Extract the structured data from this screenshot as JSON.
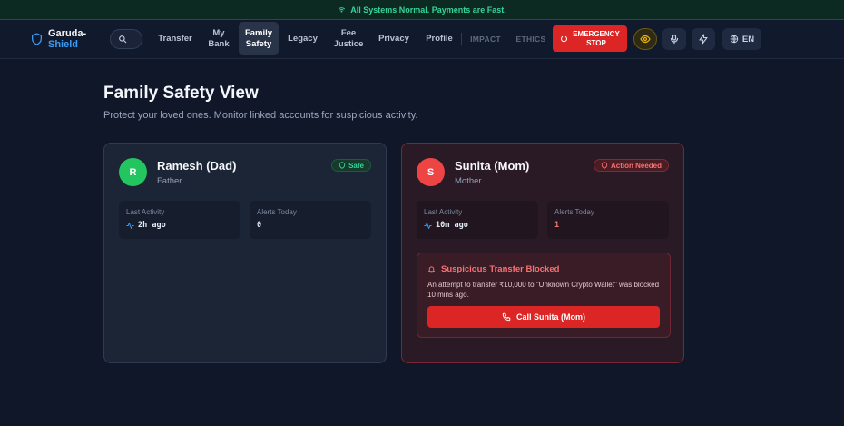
{
  "status_banner": {
    "text": "All Systems Normal. Payments are Fast.",
    "icon": "wifi-icon"
  },
  "brand": {
    "line1": "Garuda-",
    "line2": "Shield",
    "icon": "shield-icon"
  },
  "nav": {
    "items": [
      {
        "label": "Transfer"
      },
      {
        "label": "My\nBank"
      },
      {
        "label": "Family\nSafety",
        "active": true
      },
      {
        "label": "Legacy"
      },
      {
        "label": "Fee\nJustice"
      },
      {
        "label": "Privacy"
      },
      {
        "label": "Profile"
      },
      {
        "label": "IMPACT"
      },
      {
        "label": "ETHICS"
      }
    ],
    "emergency_label": "EMERGENCY\nSTOP",
    "language": "EN"
  },
  "page": {
    "title": "Family Safety View",
    "subtitle": "Protect your loved ones. Monitor linked accounts for suspicious activity."
  },
  "members": [
    {
      "initial": "R",
      "name": "Ramesh (Dad)",
      "relation": "Father",
      "status": "Safe",
      "last_activity_label": "Last Activity",
      "last_activity": "2h ago",
      "alerts_label": "Alerts Today",
      "alerts": "0"
    },
    {
      "initial": "S",
      "name": "Sunita (Mom)",
      "relation": "Mother",
      "status": "Action Needed",
      "last_activity_label": "Last Activity",
      "last_activity": "10m ago",
      "alerts_label": "Alerts Today",
      "alerts": "1",
      "alert": {
        "title": "Suspicious Transfer Blocked",
        "text": "An attempt to transfer ₹10,000 to \"Unknown Crypto Wallet\" was blocked 10 mins ago.",
        "action": "Call Sunita (Mom)"
      }
    }
  ],
  "colors": {
    "background": "#0f1729",
    "accent_blue": "#3b9cf5",
    "safe_green": "#22c55e",
    "danger_red": "#dc2626"
  }
}
